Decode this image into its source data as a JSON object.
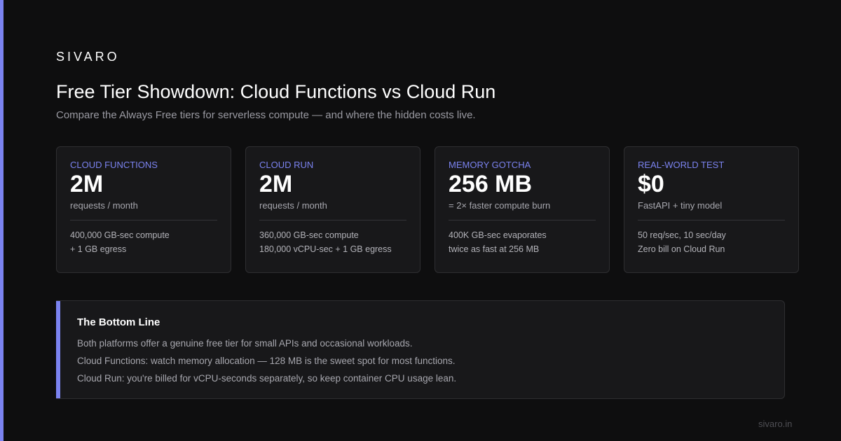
{
  "brand": "SIVARO",
  "title": "Free Tier Showdown: Cloud Functions vs Cloud Run",
  "subtitle": "Compare the Always Free tiers for serverless compute — and where the hidden costs live.",
  "cards": [
    {
      "label": "CLOUD FUNCTIONS",
      "value": "2M",
      "unit": "requests / month",
      "details": [
        "400,000 GB-sec compute",
        "+ 1 GB egress"
      ]
    },
    {
      "label": "CLOUD RUN",
      "value": "2M",
      "unit": "requests / month",
      "details": [
        "360,000 GB-sec compute",
        "180,000 vCPU-sec + 1 GB egress"
      ]
    },
    {
      "label": "MEMORY GOTCHA",
      "value": "256 MB",
      "unit": "= 2× faster compute burn",
      "details": [
        "400K GB-sec evaporates",
        "twice as fast at 256 MB"
      ]
    },
    {
      "label": "REAL-WORLD TEST",
      "value": "$0",
      "unit": "FastAPI + tiny model",
      "details": [
        "50 req/sec, 10 sec/day",
        "Zero bill on Cloud Run"
      ]
    }
  ],
  "bottom": {
    "title": "The Bottom Line",
    "lines": [
      "Both platforms offer a genuine free tier for small APIs and occasional workloads.",
      "Cloud Functions: watch memory allocation — 128 MB is the sweet spot for most functions.",
      "Cloud Run: you're billed for vCPU-seconds separately, so keep container CPU usage lean."
    ]
  },
  "footer": "sivaro.in",
  "colors": {
    "background": "#0e0e0f",
    "accent": "#7b83f0",
    "card_background": "#18181a",
    "card_border": "#2e2e31"
  }
}
